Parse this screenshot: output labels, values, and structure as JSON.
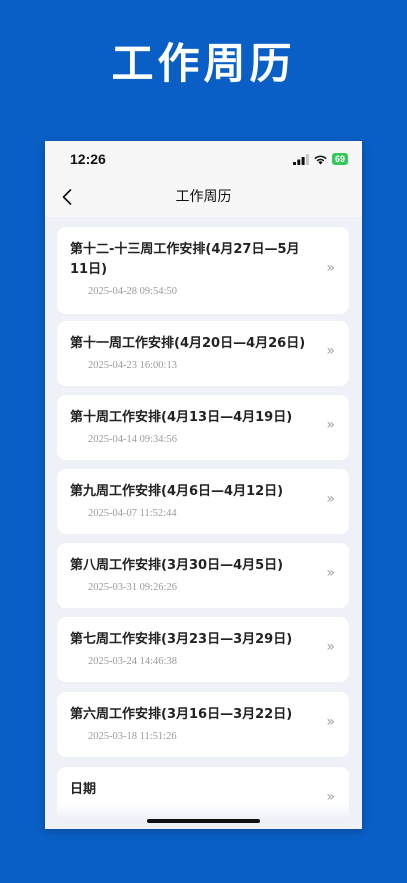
{
  "hero": {
    "title": "工作周历"
  },
  "status_bar": {
    "time": "12:26",
    "battery": "69"
  },
  "nav": {
    "title": "工作周历"
  },
  "items": [
    {
      "title": "第十二-十三周工作安排(4月27日—5月11日)",
      "date": "2025-04-28 09:54:50"
    },
    {
      "title": "第十一周工作安排(4月20日—4月26日)",
      "date": "2025-04-23 16:00:13"
    },
    {
      "title": "第十周工作安排(4月13日—4月19日)",
      "date": "2025-04-14 09:34:56"
    },
    {
      "title": "第九周工作安排(4月6日—4月12日)",
      "date": "2025-04-07 11:52:44"
    },
    {
      "title": "第八周工作安排(3月30日—4月5日)",
      "date": "2025-03-31 09:26:26"
    },
    {
      "title": "第七周工作安排(3月23日—3月29日)",
      "date": "2025-03-24 14:46:38"
    },
    {
      "title": "第六周工作安排(3月16日—3月22日)",
      "date": "2025-03-18 11:51:26"
    },
    {
      "title": "日期",
      "date": ""
    }
  ],
  "arrow_glyph": "»",
  "colors": {
    "background": "#0a5fc6",
    "card": "#ffffff",
    "list_background": "#eef2f8",
    "battery": "#34c759"
  },
  "icons": [
    "back-chevron-icon",
    "signal-icon",
    "wifi-icon",
    "battery-icon",
    "double-chevron-right-icon"
  ]
}
